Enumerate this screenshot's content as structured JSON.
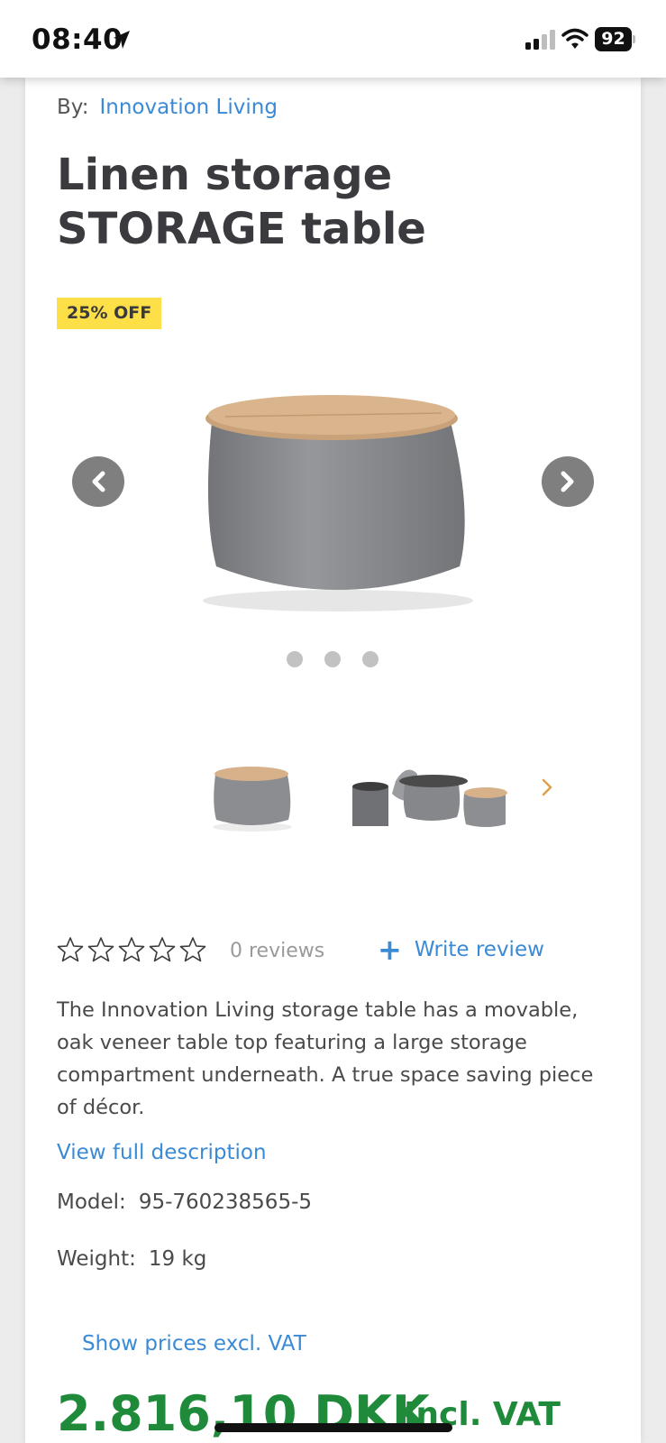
{
  "status_bar": {
    "time": "08:40",
    "battery": "92"
  },
  "product": {
    "by_label": "By:",
    "brand": "Innovation Living",
    "title": "Linen storage STORAGE table",
    "discount_badge": "25% OFF",
    "carousel": {
      "slide_count": 3,
      "active_index": 0
    },
    "rating": {
      "stars": 5,
      "filled": 0,
      "reviews_label": "0 reviews",
      "write_review_label": "Write review"
    },
    "description": "The Innovation Living storage table has a movable, oak veneer table top featuring a large storage compartment underneath. A true space saving piece of décor.",
    "view_full_description": "View full description",
    "model_label": "Model:",
    "model_value": "95-760238565-5",
    "weight_label": "Weight:",
    "weight_value": "19 kg",
    "show_prices_toggle": "Show prices excl. VAT",
    "price": "2.816,10 DKK",
    "price_suffix": "Incl. VAT"
  },
  "colors": {
    "link": "#3a8ad6",
    "price": "#1f8b3a",
    "badge": "#fde047",
    "title": "#3a3a3f"
  },
  "icons": [
    "location-arrow-icon",
    "signal-icon",
    "wifi-icon",
    "battery-icon",
    "chevron-left-icon",
    "chevron-right-icon",
    "star-outline-icon",
    "plus-icon"
  ]
}
